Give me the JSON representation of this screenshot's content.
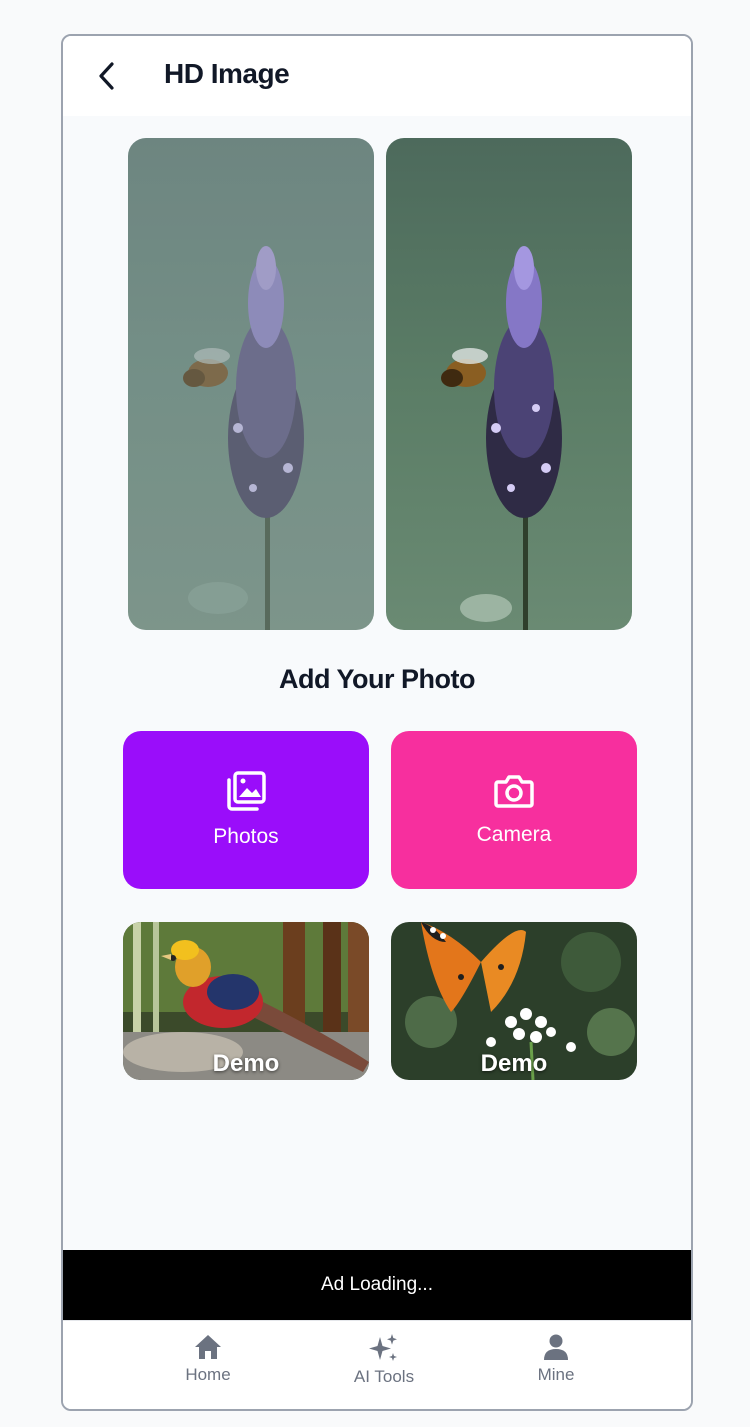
{
  "header": {
    "title": "HD Image",
    "back_icon": "chevron-left-icon"
  },
  "preview": {
    "before_label": "",
    "after_label": ""
  },
  "add_section": {
    "title": "Add Your Photo"
  },
  "actions": {
    "photos": {
      "label": "Photos",
      "icon": "gallery-icon",
      "color": "#9a0dfa"
    },
    "camera": {
      "label": "Camera",
      "icon": "camera-icon",
      "color": "#f72f9e"
    }
  },
  "demos": [
    {
      "label": "Demo",
      "image": "pheasant-photo"
    },
    {
      "label": "Demo",
      "image": "butterfly-photo"
    }
  ],
  "ad": {
    "text": "Ad Loading..."
  },
  "tabbar": {
    "items": [
      {
        "label": "Home",
        "icon": "home-icon"
      },
      {
        "label": "AI Tools",
        "icon": "sparkles-icon"
      },
      {
        "label": "Mine",
        "icon": "user-icon"
      }
    ]
  }
}
